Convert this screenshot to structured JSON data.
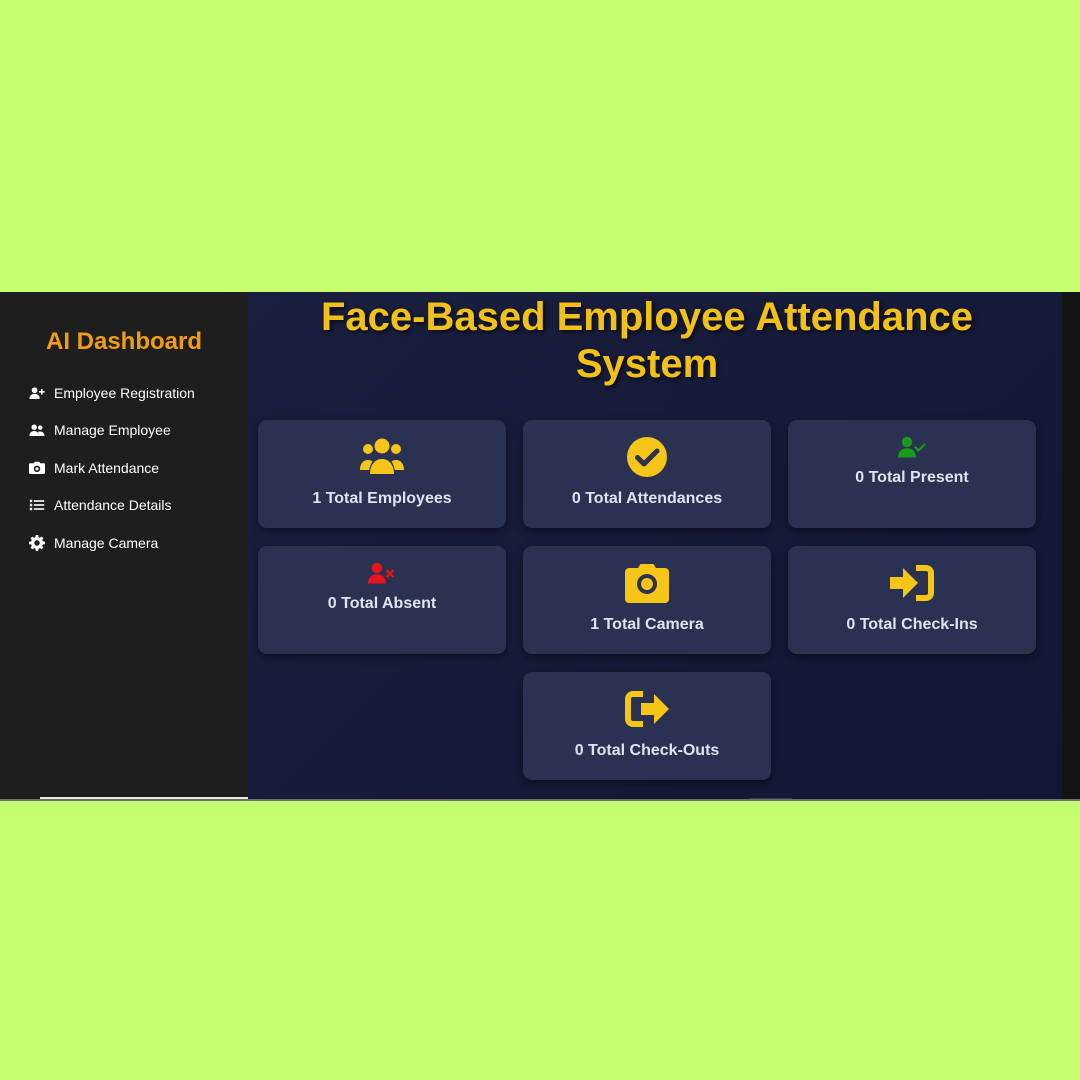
{
  "sidebar": {
    "brand": "AI Dashboard",
    "items": [
      {
        "label": "Employee Registration",
        "icon": "user-plus-icon"
      },
      {
        "label": "Manage Employee",
        "icon": "users-icon"
      },
      {
        "label": "Mark Attendance",
        "icon": "camera-icon"
      },
      {
        "label": "Attendance Details",
        "icon": "list-icon"
      },
      {
        "label": "Manage Camera",
        "icon": "gear-icon"
      }
    ]
  },
  "main": {
    "title": "Face-Based Employee Attendance System",
    "cards": [
      {
        "label": "1 Total Employees",
        "icon": "users-icon",
        "icon_color": "#f5c518"
      },
      {
        "label": "0 Total Attendances",
        "icon": "check-circle-icon",
        "icon_color": "#f5c518"
      },
      {
        "label": "0 Total Present",
        "icon": "user-check-icon",
        "icon_color": "#1a9a1a"
      },
      {
        "label": "0 Total Absent",
        "icon": "user-x-icon",
        "icon_color": "#e8141c"
      },
      {
        "label": "1 Total Camera",
        "icon": "camera-icon",
        "icon_color": "#f5c518"
      },
      {
        "label": "0 Total Check-Ins",
        "icon": "sign-in-icon",
        "icon_color": "#f5c518"
      },
      {
        "label": "0 Total Check-Outs",
        "icon": "sign-out-icon",
        "icon_color": "#f5c518"
      }
    ]
  },
  "colors": {
    "accent_title": "#f2c118",
    "brand": "#f39c12",
    "card_bg": "#2b3150",
    "page_bg": "#c5ff6f"
  }
}
